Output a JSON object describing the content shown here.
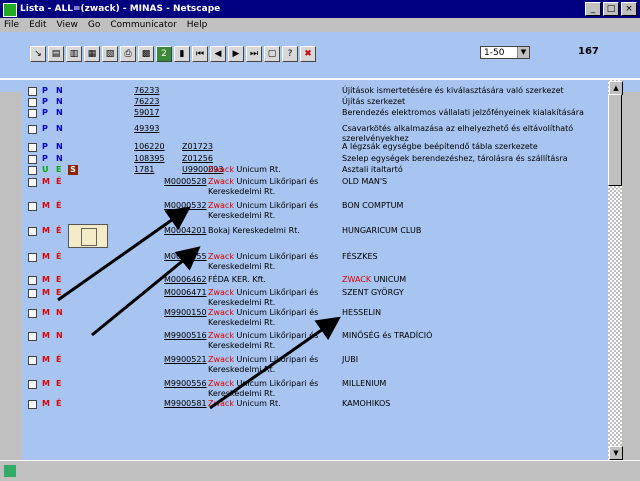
{
  "window": {
    "title": "Lista - ALL=(zwack) - MINAS - Netscape",
    "controls": {
      "minimize": "_",
      "maximize": "□",
      "close": "×"
    }
  },
  "menu": [
    "File",
    "Edit",
    "View",
    "Go",
    "Communicator",
    "Help"
  ],
  "toolbar": {
    "buttons": [
      {
        "icon": "select-icon",
        "glyph": "↘"
      },
      {
        "icon": "document-icon",
        "glyph": "▤"
      },
      {
        "icon": "document-icon",
        "glyph": "▥"
      },
      {
        "icon": "image-icon",
        "glyph": "▦"
      },
      {
        "icon": "image-icon",
        "glyph": "▧"
      },
      {
        "icon": "print-icon",
        "glyph": "⎙"
      },
      {
        "icon": "image-icon",
        "glyph": "▩"
      },
      {
        "icon": "number-icon",
        "glyph": "2"
      },
      {
        "icon": "book-icon",
        "glyph": "▮"
      },
      {
        "icon": "first-page-icon",
        "glyph": "⏮"
      },
      {
        "icon": "prev-page-icon",
        "glyph": "◀"
      },
      {
        "icon": "next-page-icon",
        "glyph": "▶"
      },
      {
        "icon": "last-page-icon",
        "glyph": "⏭"
      },
      {
        "icon": "window-icon",
        "glyph": "▢"
      },
      {
        "icon": "help-icon",
        "glyph": "?"
      },
      {
        "icon": "close-icon",
        "glyph": "✖"
      }
    ],
    "page_select": "1-50",
    "total_count": "167"
  },
  "colors": {
    "background": "#a8c4f0",
    "titlebar": "#000080",
    "red": "#dd0000",
    "blue": "#0000c8",
    "green": "#00aa00"
  },
  "rows": [
    {
      "type": "P",
      "type_color": "#0000c8",
      "status": "N",
      "ref": "76233",
      "ref2": "",
      "owner_red": "",
      "owner": "",
      "desc": "Újítások ismertetésére és kiválasztására való szerkezet",
      "desc_red": ""
    },
    {
      "type": "P",
      "type_color": "#0000c8",
      "status": "N",
      "ref": "76223",
      "ref2": "",
      "owner_red": "",
      "owner": "",
      "desc": "Újítás szerkezet",
      "desc_red": ""
    },
    {
      "type": "P",
      "type_color": "#0000c8",
      "status": "N",
      "ref": "59017",
      "ref2": "",
      "owner_red": "",
      "owner": "",
      "desc": "Berendezés elektromos vállalati jelzőfényeinek kialakítására",
      "desc_red": ""
    },
    {
      "type": "P",
      "type_color": "#0000c8",
      "status": "N",
      "ref": "49393",
      "ref2": "",
      "owner_red": "",
      "owner": "",
      "desc": "Csavarkötés alkalmazása az elhelyezhető és eltávolítható szerelvényekhez",
      "desc_red": ""
    },
    {
      "type": "P",
      "type_color": "#0000c8",
      "status": "N",
      "ref": "106220",
      "ref2": "Z01723",
      "owner_red": "",
      "owner": "",
      "desc": "A légzsák egységbe beépítendő tábla szerkezete",
      "desc_red": ""
    },
    {
      "type": "P",
      "type_color": "#0000c8",
      "status": "N",
      "ref": "108395",
      "ref2": "Z01256",
      "owner_red": "",
      "owner": "",
      "desc": "Szelep egységek berendezéshez, tárolásra és szállításra",
      "desc_red": ""
    },
    {
      "type": "U",
      "type_color": "#0a0",
      "status": "E",
      "ref": "1781",
      "ref2": "U9900093",
      "owner_red": "Zwack",
      "owner": " Unicum Rt.",
      "desc": "Asztali italtartó",
      "desc_red": "",
      "badge": "S"
    },
    {
      "type": "M",
      "type_color": "#d00",
      "status": "É",
      "ref": "",
      "ref2": "M0000528",
      "owner_red": "Zwack",
      "owner": " Unicum Likőripari és Kereskedelmi Rt.",
      "desc": "OLD MAN'S",
      "desc_red": ""
    },
    {
      "type": "M",
      "type_color": "#d00",
      "status": "É",
      "ref": "",
      "ref2": "M0000532",
      "owner_red": "Zwack",
      "owner": " Unicum Likőripari és Kereskedelmi Rt.",
      "desc": "BON COMPTUM",
      "desc_red": ""
    },
    {
      "type": "M",
      "type_color": "#d00",
      "status": "É",
      "ref": "",
      "ref2": "M0004201",
      "owner_red": "",
      "owner": "Bokaj Kereskedelmi Rt.",
      "desc": "HUNGARICUM CLUB",
      "desc_red": "",
      "thumbnail": true
    },
    {
      "type": "M",
      "type_color": "#d00",
      "status": "É",
      "ref": "",
      "ref2": "M0006155",
      "owner_red": "Zwack",
      "owner": " Unicum Likőripari és Kereskedelmi Rt.",
      "desc": "FÉSZKES",
      "desc_red": ""
    },
    {
      "type": "M",
      "type_color": "#d00",
      "status": "E",
      "ref": "",
      "ref2": "M0006462",
      "owner_red": "",
      "owner": "FÉDA KER. Kft.",
      "desc": " UNICUM",
      "desc_red": "ZWACK"
    },
    {
      "type": "M",
      "type_color": "#d00",
      "status": "E",
      "ref": "",
      "ref2": "M0006471",
      "owner_red": "Zwack",
      "owner": " Unicum Likőripari és Kereskedelmi Rt.",
      "desc": "SZENT GYÖRGY",
      "desc_red": ""
    },
    {
      "type": "M",
      "type_color": "#d00",
      "status": "N",
      "ref": "",
      "ref2": "M9900150",
      "owner_red": "Zwack",
      "owner": " Unicum Likőripari és Kereskedelmi Rt.",
      "desc": "HESSELIN",
      "desc_red": ""
    },
    {
      "type": "M",
      "type_color": "#d00",
      "status": "N",
      "ref": "",
      "ref2": "M9900516",
      "owner_red": "Zwack",
      "owner": " Unicum Likőripari és Kereskedelmi Rt.",
      "desc": "MINŐSÉG és TRADÍCIÓ",
      "desc_red": ""
    },
    {
      "type": "M",
      "type_color": "#d00",
      "status": "É",
      "ref": "",
      "ref2": "M9900521",
      "owner_red": "Zwack",
      "owner": " Unicum Likőripari és Kereskedelmi Rt.",
      "desc": "JUBI",
      "desc_red": ""
    },
    {
      "type": "M",
      "type_color": "#d00",
      "status": "E",
      "ref": "",
      "ref2": "M9900556",
      "owner_red": "Zwack",
      "owner": " Unicum Likőripari és Kereskedelmi Rt.",
      "desc": "MILLENIUM",
      "desc_red": ""
    },
    {
      "type": "M",
      "type_color": "#d00",
      "status": "É",
      "ref": "",
      "ref2": "M9900581",
      "owner_red": "Zwack",
      "owner": " Unicum Rt.",
      "desc": "KAMOHIKOS",
      "desc_red": ""
    }
  ]
}
